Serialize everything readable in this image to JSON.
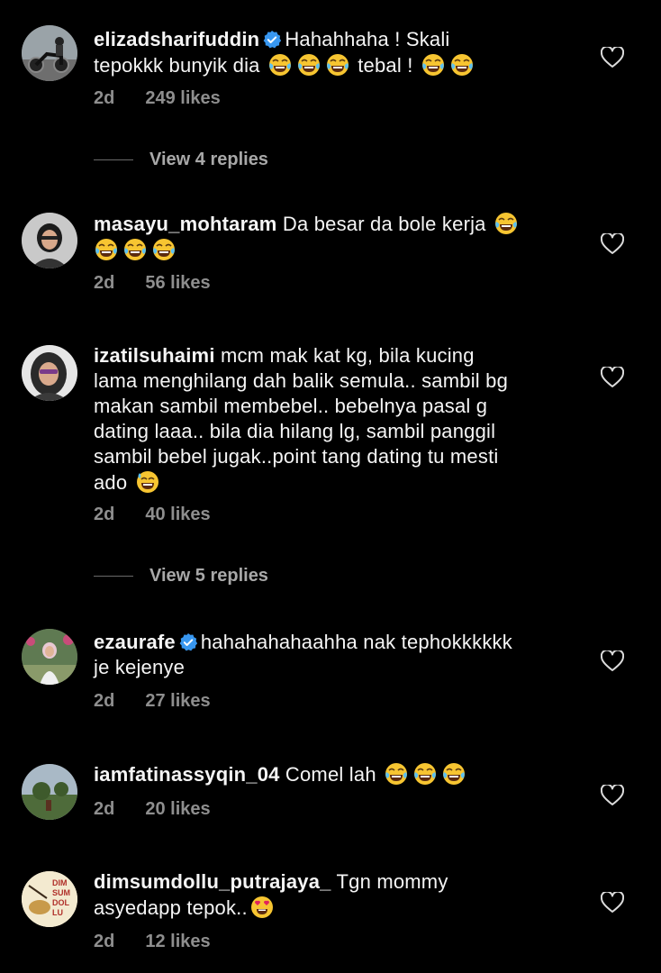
{
  "comments": [
    {
      "username": "elizadsharifuddin",
      "verified": true,
      "line1": "Hahahhaha ! Skali",
      "line2_before": "tepokkk bunyik dia ",
      "line2_mid": " tebal ! ",
      "time": "2d",
      "likes": "249 likes",
      "replies": "View 4 replies"
    },
    {
      "username": "masayu_mohtaram",
      "verified": false,
      "text": "Da besar da bole kerja",
      "time": "2d",
      "likes": "56 likes"
    },
    {
      "username": "izatilsuhaimi",
      "verified": false,
      "lines": [
        "mcm mak kat kg, bila kucing",
        "lama menghilang dah balik semula.. sambil bg",
        "makan sambil membebel.. bebelnya pasal g",
        "dating laaa.. bila dia hilang lg, sambil panggil",
        "sambil bebel jugak..point tang dating tu mesti",
        "ado"
      ],
      "time": "2d",
      "likes": "40 likes",
      "replies": "View 5 replies"
    },
    {
      "username": "ezaurafe",
      "verified": true,
      "line1": "hahahahahaahha nak tephokkkkkk",
      "line2": "je kejenye",
      "time": "2d",
      "likes": "27 likes"
    },
    {
      "username": "iamfatinassyqin_04",
      "verified": false,
      "text": "Comel lah",
      "time": "2d",
      "likes": "20 likes"
    },
    {
      "username": "dimsumdollu_putrajaya_",
      "verified": false,
      "line1": "Tgn mommy",
      "line2": "asyedapp tepok..",
      "time": "2d",
      "likes": "12 likes",
      "avatar_text": [
        "DIM",
        "SUM",
        "DOL",
        "LU"
      ]
    }
  ],
  "colors": {
    "background": "#000000",
    "text": "#f5f5f5",
    "meta": "#8e8e8e",
    "verified": "#3897f0",
    "emoji_face": "#f7c531"
  },
  "icons": [
    "heart-outline-icon",
    "verified-badge-icon",
    "laughing-tears-emoji",
    "sweat-smile-emoji",
    "heart-eyes-emoji"
  ]
}
